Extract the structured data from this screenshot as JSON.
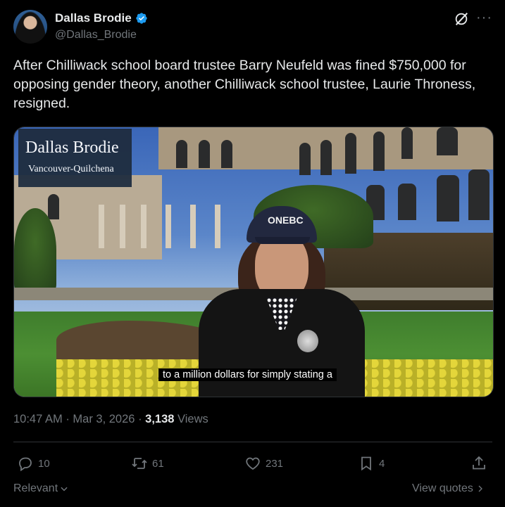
{
  "author": {
    "display_name": "Dallas Brodie",
    "handle": "@Dallas_Brodie",
    "verified": true,
    "verified_color": "#1d9bf0"
  },
  "header_icons": [
    "grok-icon",
    "more-icon"
  ],
  "more_label": "···",
  "tweet": {
    "text": "After Chilliwack school board trustee Barry Neufeld was fined $750,000 for opposing gender theory, another Chilliwack school trustee, Laurie Throness, resigned."
  },
  "media": {
    "type": "video",
    "name_card_title": "Dallas Brodie",
    "name_card_subtitle": "Vancouver-Quilchena",
    "cap_logo": "ONEBC",
    "caption": "to a million dollars for simply stating a"
  },
  "meta": {
    "time": "10:47 AM",
    "separator": "·",
    "date": "Mar 3, 2026",
    "views_count": "3,138",
    "views_label": "Views"
  },
  "actions": {
    "replies": "10",
    "reposts": "61",
    "likes": "231",
    "bookmarks": "4"
  },
  "footer": {
    "sort_label": "Relevant",
    "view_quotes_label": "View quotes"
  }
}
